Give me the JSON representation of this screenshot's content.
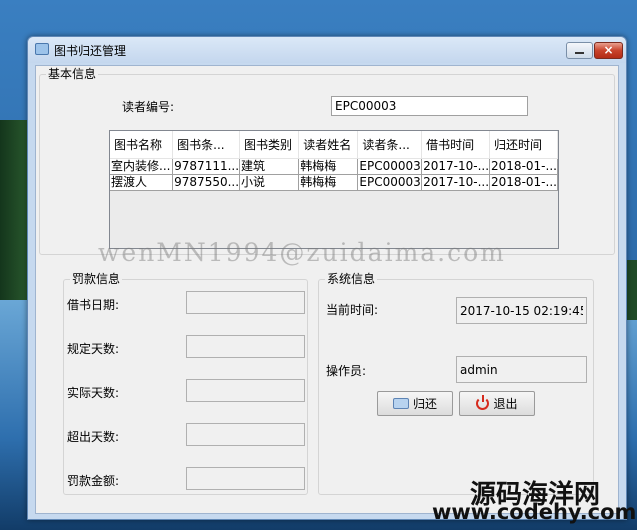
{
  "window": {
    "title": "图书归还管理",
    "close_glyph": "×"
  },
  "basic_info": {
    "legend": "基本信息",
    "reader_id_label": "读者编号:",
    "reader_id_value": "EPC00003"
  },
  "grid": {
    "columns": [
      "图书名称",
      "图书条...",
      "图书类别",
      "读者姓名",
      "读者条...",
      "借书时间",
      "归还时间"
    ],
    "rows": [
      [
        "室内装修...",
        "9787111...",
        "建筑",
        "韩梅梅",
        "EPC00003",
        "2017-10-...",
        "2018-01-..."
      ],
      [
        "摆渡人",
        "9787550...",
        "小说",
        "韩梅梅",
        "EPC00003",
        "2017-10-...",
        "2018-01-..."
      ]
    ]
  },
  "fine_info": {
    "legend": "罚款信息",
    "fields": [
      {
        "label": "借书日期:",
        "value": ""
      },
      {
        "label": "规定天数:",
        "value": ""
      },
      {
        "label": "实际天数:",
        "value": ""
      },
      {
        "label": "超出天数:",
        "value": ""
      },
      {
        "label": "罚款金额:",
        "value": ""
      }
    ]
  },
  "system_info": {
    "legend": "系统信息",
    "time_label": "当前时间:",
    "time_value": "2017-10-15 02:19:45",
    "operator_label": "操作员:",
    "operator_value": "admin"
  },
  "buttons": {
    "return_label": "归还",
    "exit_label": "退出",
    "return_icon": "return-icon",
    "exit_icon": "power-icon"
  },
  "overlay": {
    "watermark": "wenMN1994@zuidaima.com",
    "site_name": "源码海洋网",
    "site_url": "www.codehy.com"
  }
}
